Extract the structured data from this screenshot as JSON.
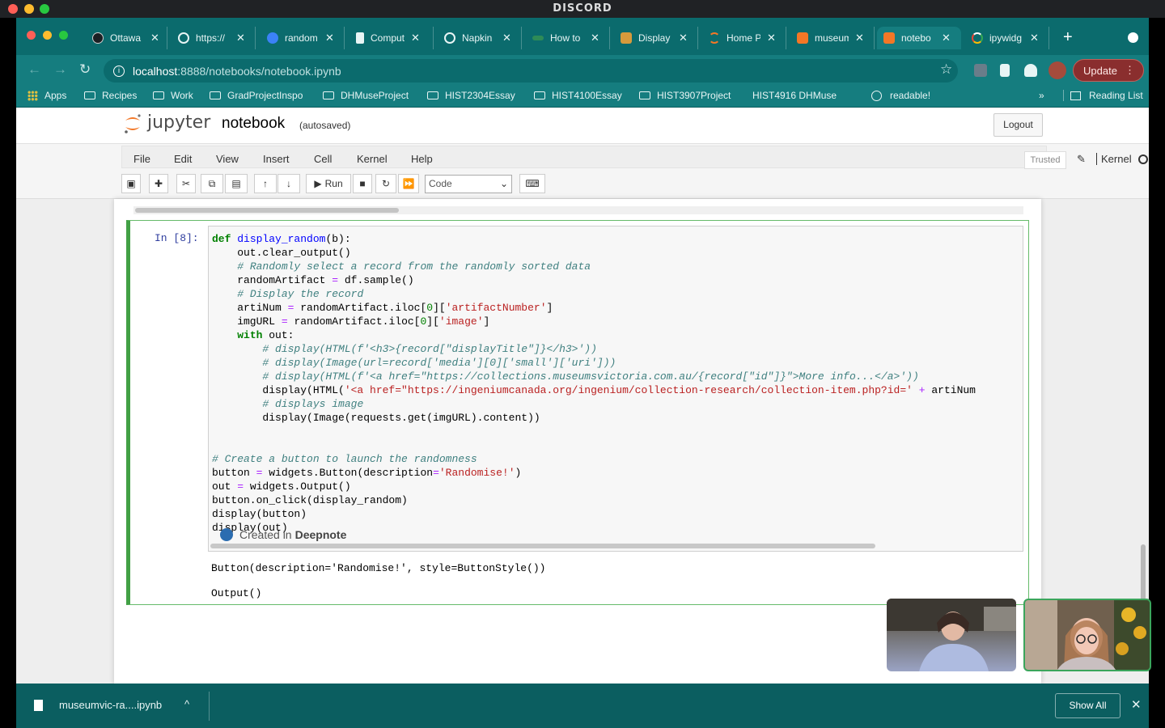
{
  "discord": {
    "title": "DISCORD"
  },
  "browser": {
    "tabs": [
      {
        "label": "Ottawa",
        "icon": "github-icon"
      },
      {
        "label": "https://",
        "icon": "globe-icon"
      },
      {
        "label": "random",
        "icon": "deepnote-icon"
      },
      {
        "label": "Comput",
        "icon": "page-icon"
      },
      {
        "label": "Napkin",
        "icon": "globe-icon"
      },
      {
        "label": "How to",
        "icon": "site-icon"
      },
      {
        "label": "Display",
        "icon": "site-icon"
      },
      {
        "label": "Home P",
        "icon": "jupyter-icon"
      },
      {
        "label": "museum",
        "icon": "jupyter-notebook-icon"
      },
      {
        "label": "notebo",
        "icon": "jupyter-notebook-icon",
        "active": true
      },
      {
        "label": "ipywidg",
        "icon": "google-icon"
      }
    ],
    "url_host": "localhost",
    "url_path": ":8888/notebooks/notebook.ipynb",
    "update_label": "Update",
    "bookmarks": [
      "Apps",
      "Recipes",
      "Work",
      "GradProjectInspo",
      "DHMuseProject",
      "HIST2304Essay",
      "HIST4100Essay",
      "HIST3907Project",
      "HIST4916 DHMuse",
      "readable!"
    ],
    "bookmarks_more": "»",
    "reading_list": "Reading List"
  },
  "jupyter": {
    "brand": "jupyter",
    "notebook_name": "notebook",
    "autosave": "(autosaved)",
    "logout": "Logout",
    "menu": [
      "File",
      "Edit",
      "View",
      "Insert",
      "Cell",
      "Kernel",
      "Help"
    ],
    "trusted": "Trusted",
    "kernel": "Kernel",
    "run_label": "Run",
    "cell_type": "Code",
    "prompt": "In [8]:",
    "outputs": [
      "Button(description='Randomise!', style=ButtonStyle())",
      "Output()"
    ],
    "created_in": "Created in",
    "deepnote": "Deepnote"
  },
  "downloads": {
    "file": "museumvic-ra....ipynb",
    "show_all": "Show All"
  },
  "colors": {
    "chrome_teal": "#157d7f",
    "selected_cell": "#42a045"
  }
}
